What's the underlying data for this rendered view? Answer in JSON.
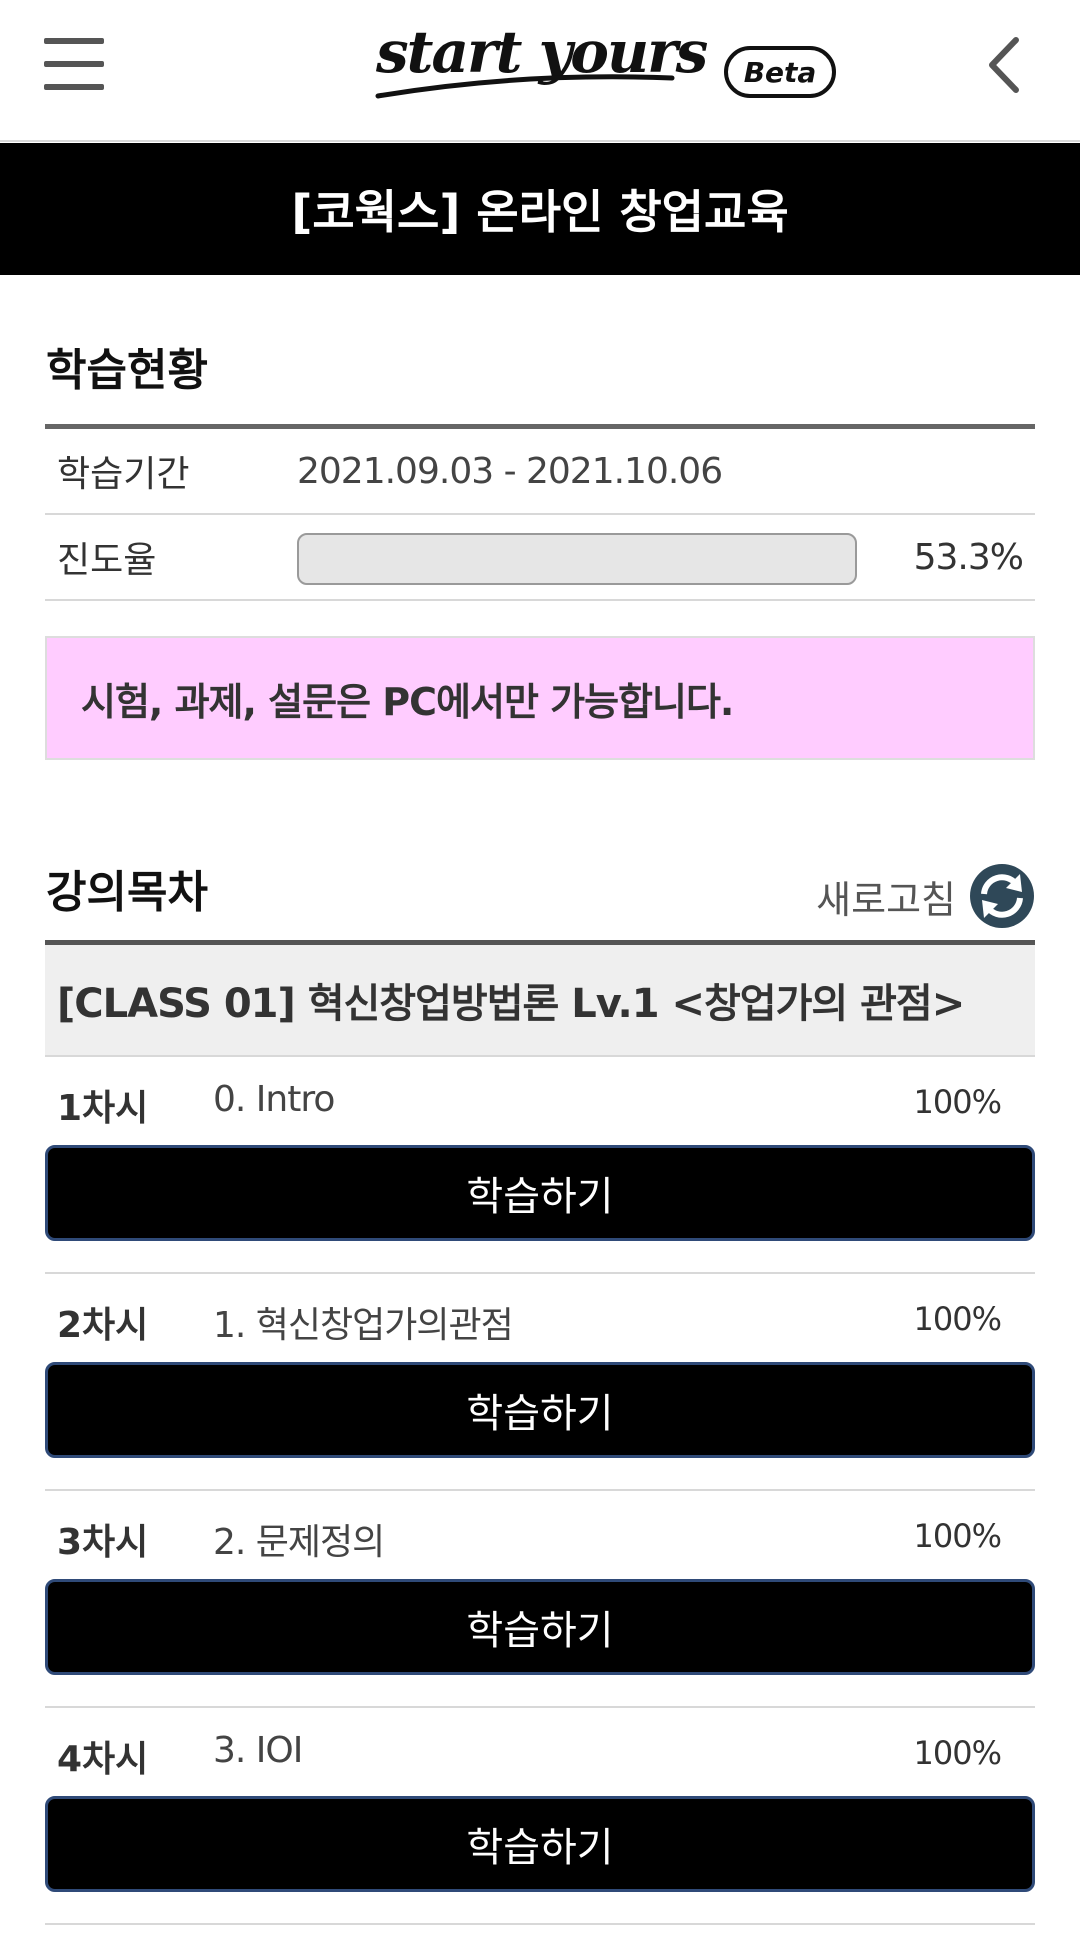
{
  "header": {
    "logo_text": "start yours",
    "beta_label": "Beta"
  },
  "course": {
    "title": "[코웍스] 온라인 창업교육"
  },
  "status": {
    "section_title": "학습현황",
    "period_label": "학습기간",
    "period_value": "2021.09.03 - 2021.10.06",
    "progress_label": "진도율",
    "progress_percent_text": "53.3%",
    "progress_fill_fraction": 0.0
  },
  "notice": {
    "text": "시험, 과제, 설문은 PC에서만 가능합니다."
  },
  "lectures": {
    "section_title": "강의목차",
    "refresh_label": "새로고침",
    "class_title": "[CLASS 01] 혁신창업방법론 Lv.1 <창업가의 관점>",
    "items": [
      {
        "num": "1차시",
        "title": "0. Intro",
        "percent": "100%",
        "button": "학습하기"
      },
      {
        "num": "2차시",
        "title": "1. 혁신창업가의관점",
        "percent": "100%",
        "button": "학습하기"
      },
      {
        "num": "3차시",
        "title": "2. 문제정의",
        "percent": "100%",
        "button": "학습하기"
      },
      {
        "num": "4차시",
        "title": "3. IOI",
        "percent": "100%",
        "button": "학습하기"
      }
    ]
  },
  "colors": {
    "course_bar_bg": "#000000",
    "notice_bg": "#ffccff",
    "button_bg": "#000000",
    "button_border": "#2f4a78",
    "refresh_icon": "#2f4858"
  },
  "icons": {
    "menu": "hamburger-menu-icon",
    "back": "chevron-left-icon",
    "refresh": "refresh-icon"
  }
}
